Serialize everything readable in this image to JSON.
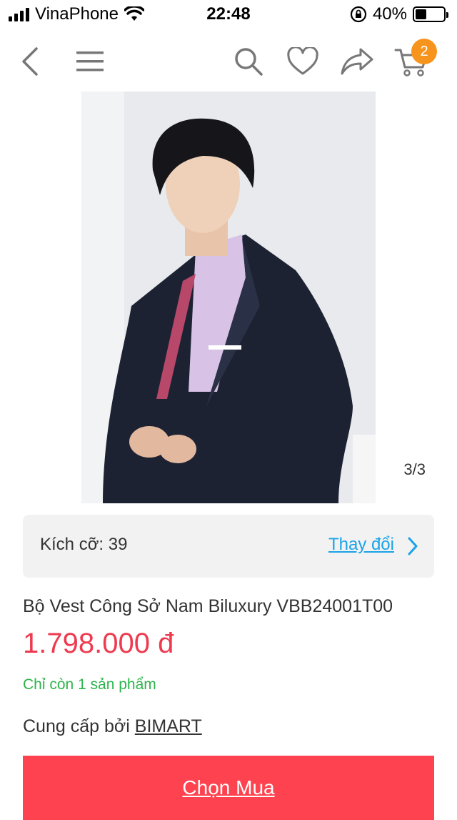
{
  "status_bar": {
    "carrier": "VinaPhone",
    "time": "22:48",
    "battery_percent": "40%",
    "battery_level": 0.4
  },
  "toolbar": {
    "icons": [
      "back-icon",
      "menu-icon",
      "search-icon",
      "heart-icon",
      "share-icon",
      "cart-icon"
    ],
    "cart_count": "2"
  },
  "gallery": {
    "counter": "3/3"
  },
  "size": {
    "label": "Kích cỡ: 39",
    "change_label": "Thay đổi"
  },
  "product": {
    "name": "Bộ Vest Công Sở Nam Biluxury VBB24001T00",
    "price": "1.798.000 đ",
    "stock_note": "Chỉ còn 1 sản phẩm",
    "supplier_prefix": "Cung cấp bởi",
    "supplier_name": "BIMART"
  },
  "actions": {
    "buy_label": "Chọn Mua"
  },
  "colors": {
    "accent": "#ff424f",
    "price": "#ee3a4f",
    "link": "#1aa3e8",
    "stock": "#2db44b",
    "badge": "#f7941d"
  }
}
